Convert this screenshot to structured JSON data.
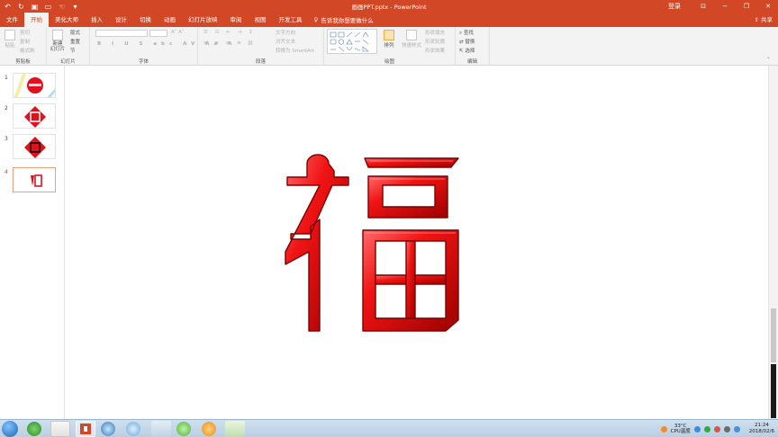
{
  "window": {
    "title": "画画PPT.pptx - PowerPoint",
    "signin": "登录",
    "share": "共享",
    "tell_me": "告诉我你想要做什么"
  },
  "tabs": [
    "文件",
    "开始",
    "美化大师",
    "插入",
    "设计",
    "切换",
    "动画",
    "幻灯片放映",
    "审阅",
    "视图",
    "开发工具"
  ],
  "ribbon": {
    "clipboard": {
      "label": "剪贴板",
      "paste": "粘贴",
      "cut": "剪切",
      "copy": "复制",
      "format_painter": "格式刷"
    },
    "slides": {
      "label": "幻灯片",
      "new_slide": "新建\n幻灯片",
      "layout": "版式",
      "reset": "重置",
      "section": "节"
    },
    "font": {
      "label": "字体",
      "font_name": "",
      "font_size": ""
    },
    "paragraph": {
      "label": "段落",
      "text_direction": "文字方向",
      "align_text": "对齐文本",
      "smartart": "转换为 SmartArt"
    },
    "drawing": {
      "label": "绘图",
      "arrange": "排列",
      "quick_styles": "快速样式",
      "shape_fill": "形状填充",
      "shape_outline": "形状轮廓",
      "shape_effects": "形状效果"
    },
    "editing": {
      "label": "编辑",
      "find": "查找",
      "replace": "替换",
      "select": "选择"
    }
  },
  "slides": [
    {
      "num": "1",
      "active": false
    },
    {
      "num": "2",
      "active": false
    },
    {
      "num": "3",
      "active": false
    },
    {
      "num": "4",
      "active": true
    }
  ],
  "taskbar": {
    "temperature": "33°C",
    "cpu": "CPU温度",
    "time": "21:24",
    "date": "2018/02/6"
  }
}
